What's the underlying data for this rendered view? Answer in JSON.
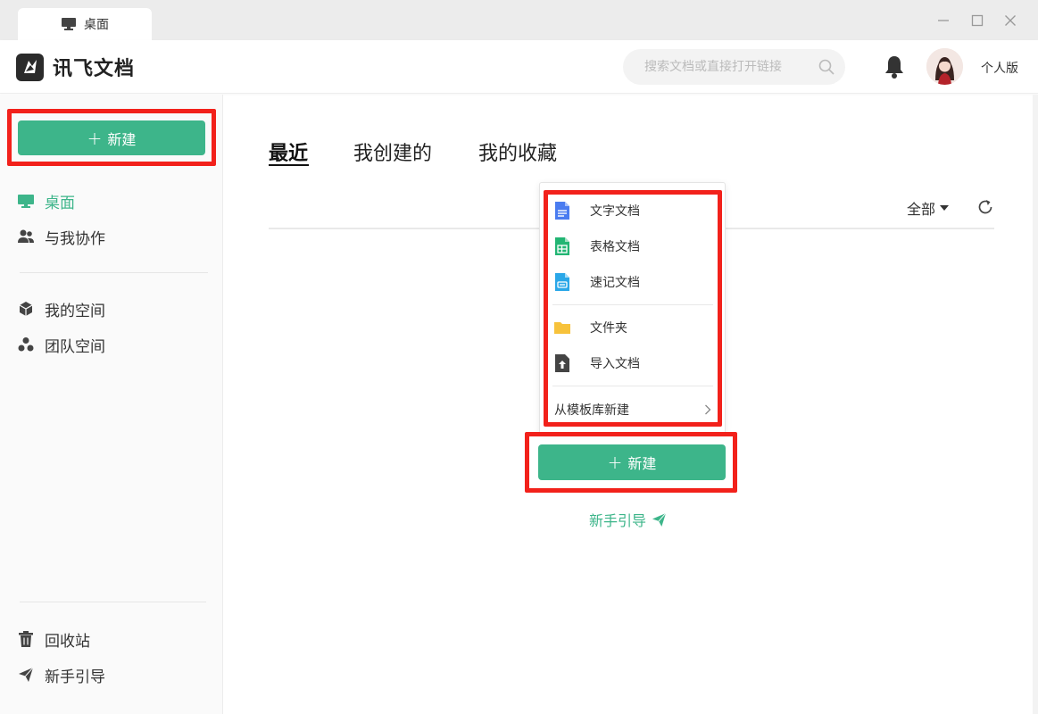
{
  "window": {
    "tab_title": "桌面",
    "controls": [
      "minimize",
      "maximize",
      "close"
    ]
  },
  "header": {
    "app_name": "讯飞文档",
    "search_placeholder": "搜索文档或直接打开链接",
    "edition": "个人版"
  },
  "sidebar": {
    "new_button": "新建",
    "items": [
      {
        "label": "桌面",
        "icon": "monitor-icon",
        "active": true
      },
      {
        "label": "与我协作",
        "icon": "users-icon"
      },
      {
        "label": "我的空间",
        "icon": "cube-icon"
      },
      {
        "label": "团队空间",
        "icon": "team-icon"
      }
    ],
    "bottom_items": [
      {
        "label": "回收站",
        "icon": "trash-icon"
      },
      {
        "label": "新手引导",
        "icon": "paper-plane-icon"
      }
    ]
  },
  "main": {
    "tabs": [
      {
        "label": "最近",
        "active": true
      },
      {
        "label": "我创建的"
      },
      {
        "label": "我的收藏"
      }
    ],
    "filter_label": "全部",
    "new_button": "新建",
    "guide_link": "新手引导"
  },
  "dropdown": {
    "items": [
      {
        "label": "文字文档",
        "icon": "word-doc-icon",
        "color": "#4a7cf0"
      },
      {
        "label": "表格文档",
        "icon": "sheet-doc-icon",
        "color": "#22b573"
      },
      {
        "label": "速记文档",
        "icon": "note-doc-icon",
        "color": "#2aa7e8"
      },
      {
        "label": "文件夹",
        "icon": "folder-icon",
        "color": "#f7c23b"
      },
      {
        "label": "导入文档",
        "icon": "import-icon",
        "color": "#444444"
      }
    ],
    "template_label": "从模板库新建"
  },
  "colors": {
    "accent": "#3db58a",
    "highlight": "#f2211b"
  }
}
